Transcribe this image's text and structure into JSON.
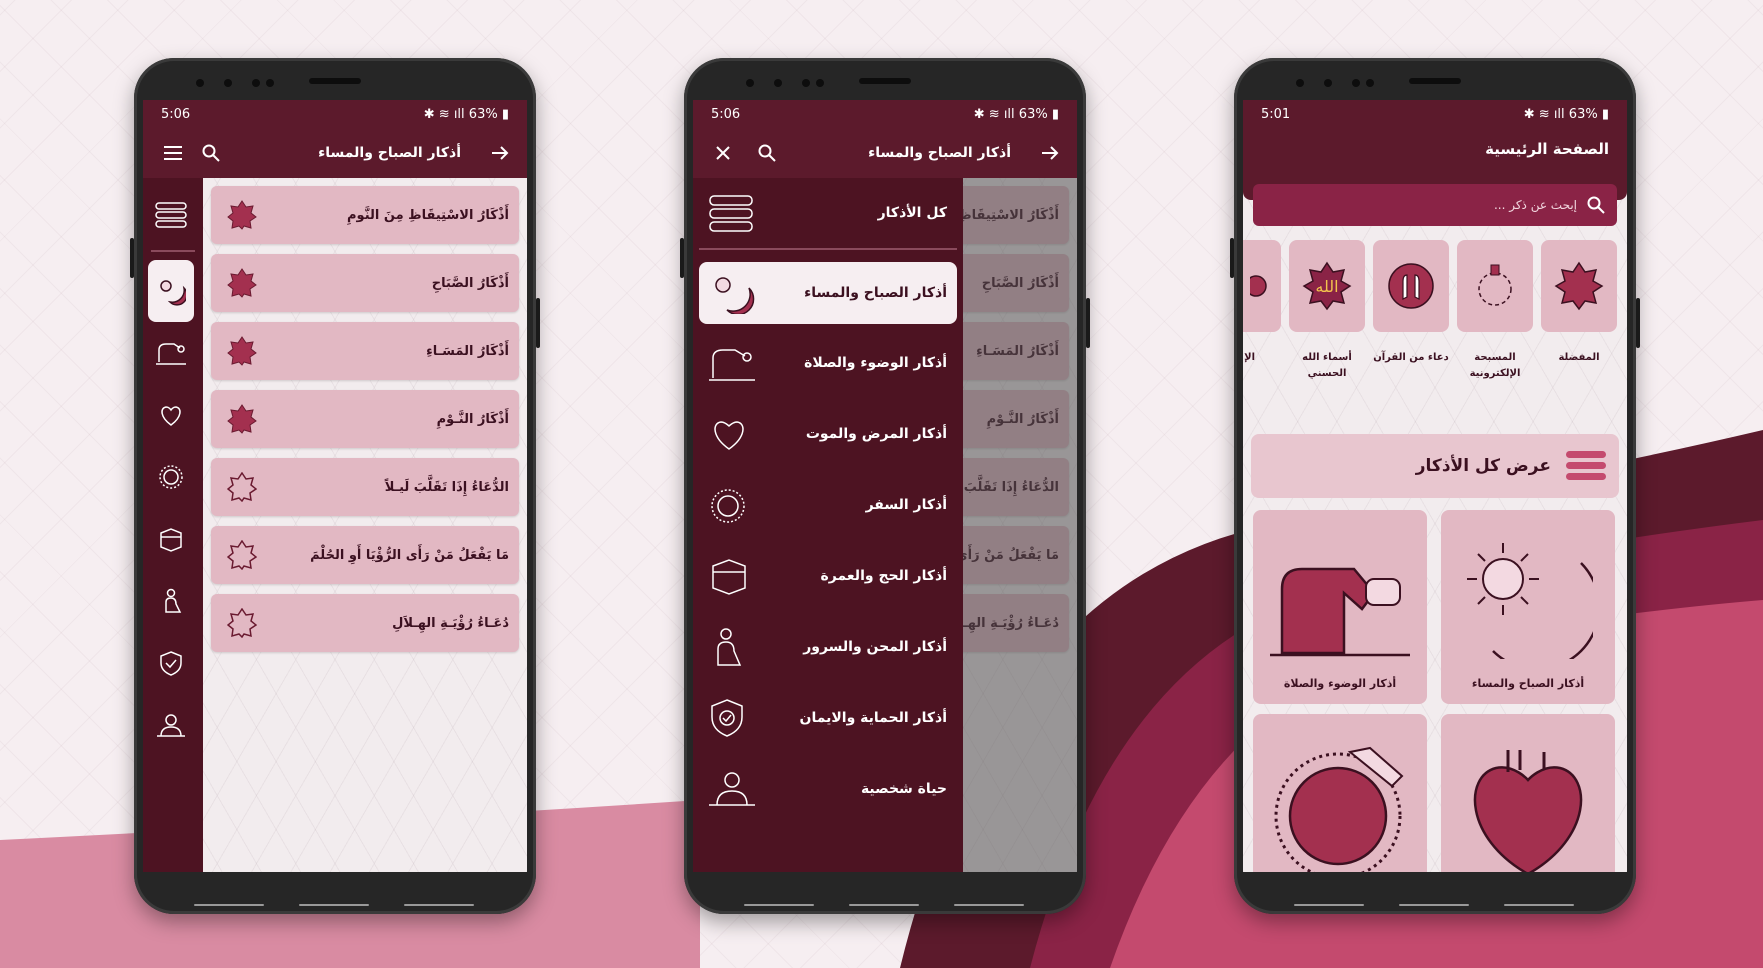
{
  "colors": {
    "primary": "#5c1a2c",
    "primary_dark": "#4d1322",
    "accent": "#a3304f",
    "card": "#e2b8c3",
    "background": "#f6eef1"
  },
  "status": {
    "battery": "63%"
  },
  "phone1": {
    "time": "5:06",
    "title": "أذكار الصباح والمساء",
    "items": [
      "أَذْكَارُ الاسْتِيقَاظِ مِنَ النَّومِ",
      "أَذْكَارُ الصَّبَاحِ",
      "أَذْكَارُ المَسَـاءِ",
      "أَذْكَارُ النَّـوْمِ",
      "الدُّعَاءُ إِذَا تَقَلَّبَ لَيـلاً",
      "مَا يَفْعَلُ مَنْ رَأَى الرُّؤْيَا أَوِ الحُلْمَ",
      "دُعَـاءُ رُؤْيَـةِ الهِـلاَلِ"
    ]
  },
  "phone2": {
    "time": "5:06",
    "title": "أذكار الصباح والمساء",
    "drawer_items": [
      "كل الأذكار",
      "أذكار الصباح والمساء",
      "أذكار الوضوء والصلاة",
      "أذكار المرض والموت",
      "أذكار السفر",
      "أذكار الحج والعمرة",
      "أذكار المحن والسرور",
      "أذكار الحماية والايمان",
      "حياة شخصية"
    ]
  },
  "phone3": {
    "time": "5:01",
    "title": "الصفحة الرئيسية",
    "search_placeholder": "إبحث عن ذكر ...",
    "categories": [
      "المفضلة",
      "المسبحة الإلكترونية",
      "دعاء من القرآن",
      "أسماء الله الحسني",
      "الإ"
    ],
    "all_label": "عرض كل الأذكار",
    "tiles": [
      "أذكار الصباح والمساء",
      "أذكار الوضوء والصلاة",
      "",
      ""
    ]
  }
}
